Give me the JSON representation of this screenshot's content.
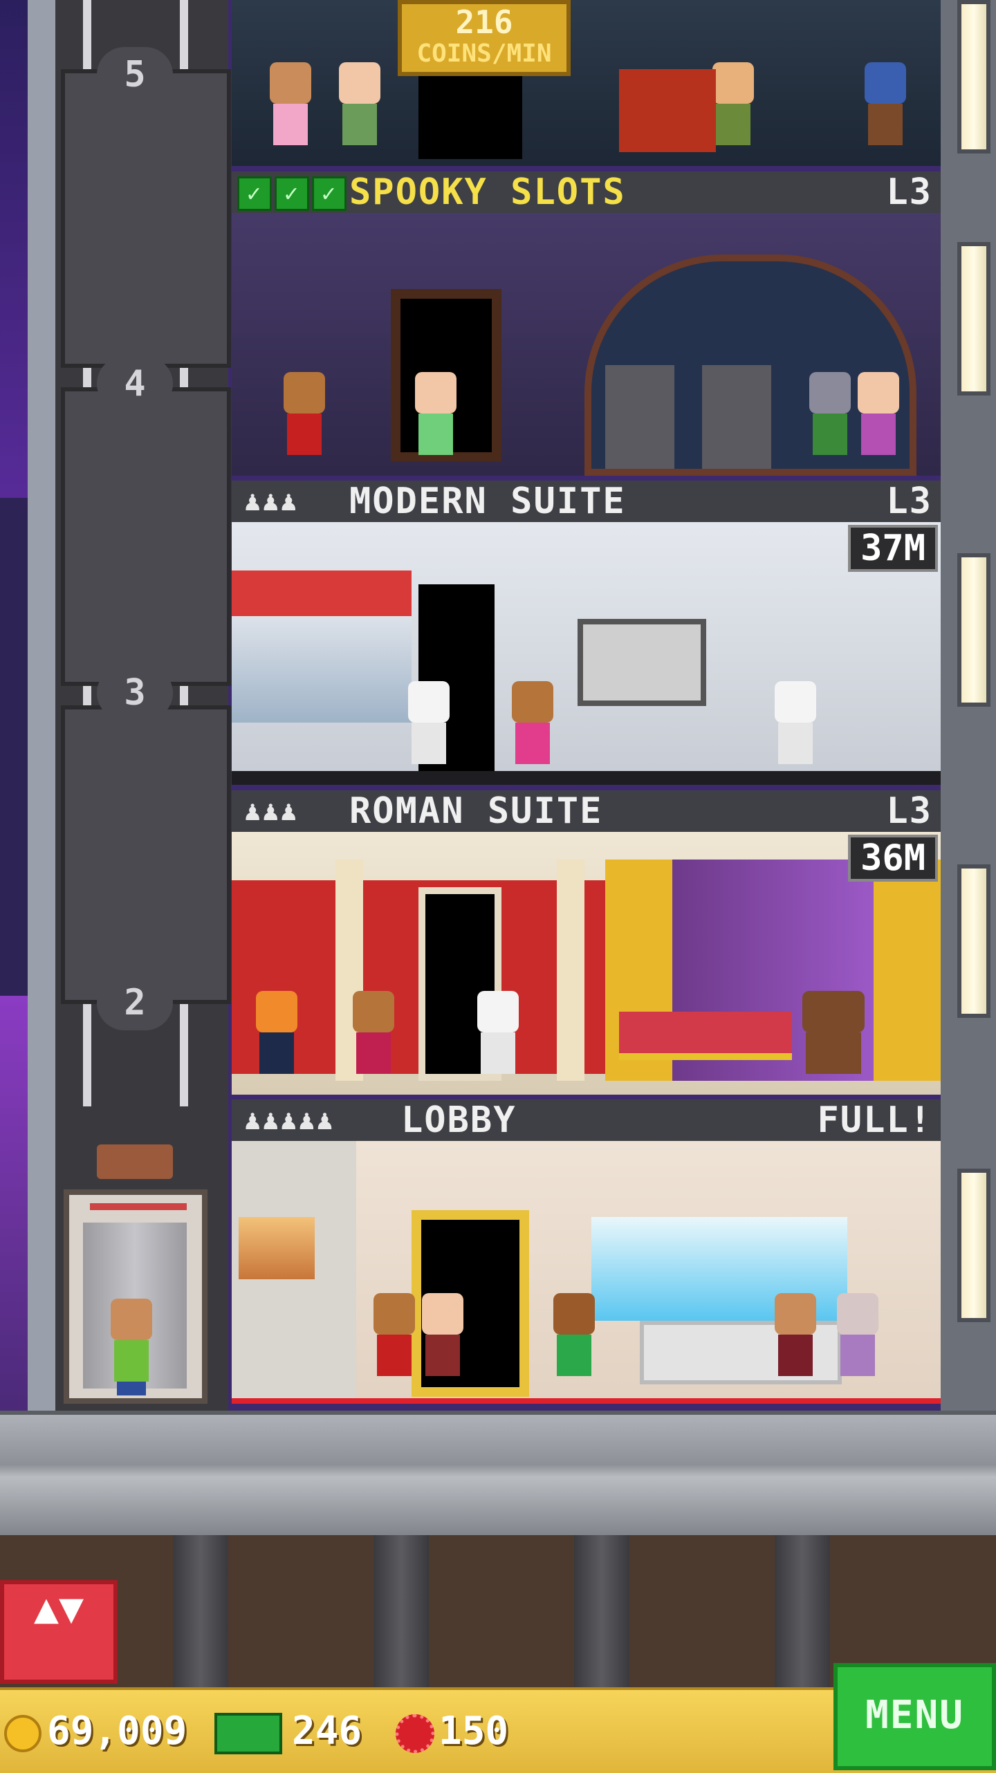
{
  "top_floor": {
    "floor_number": "5",
    "coins_rate_value": "216",
    "coins_rate_unit": "COINS/MIN"
  },
  "floors": [
    {
      "number": "4",
      "name": "SPOOKY SLOTS",
      "level": "L3",
      "checks": [
        "✓",
        "✓",
        "✓"
      ]
    },
    {
      "number": "3",
      "name": "MODERN SUITE",
      "level": "L3",
      "occupancy": "♟♟♟",
      "rent": "37M"
    },
    {
      "number": "2",
      "name": "ROMAN SUITE",
      "level": "L3",
      "occupancy": "♟♟♟",
      "rent": "36M"
    },
    {
      "name": "LOBBY",
      "status": "FULL!",
      "occupancy": "♟♟♟♟♟"
    }
  ],
  "bottom_bar": {
    "coins": "69,009",
    "bux": "246",
    "chips": "150",
    "menu_label": "MENU"
  },
  "elevator_button_glyphs": "▲▼",
  "colors": {
    "elevator_button": "#e23a46",
    "menu_button": "#2fbf3e",
    "bar": "#f6d45a",
    "check": "#1f9b2a"
  }
}
